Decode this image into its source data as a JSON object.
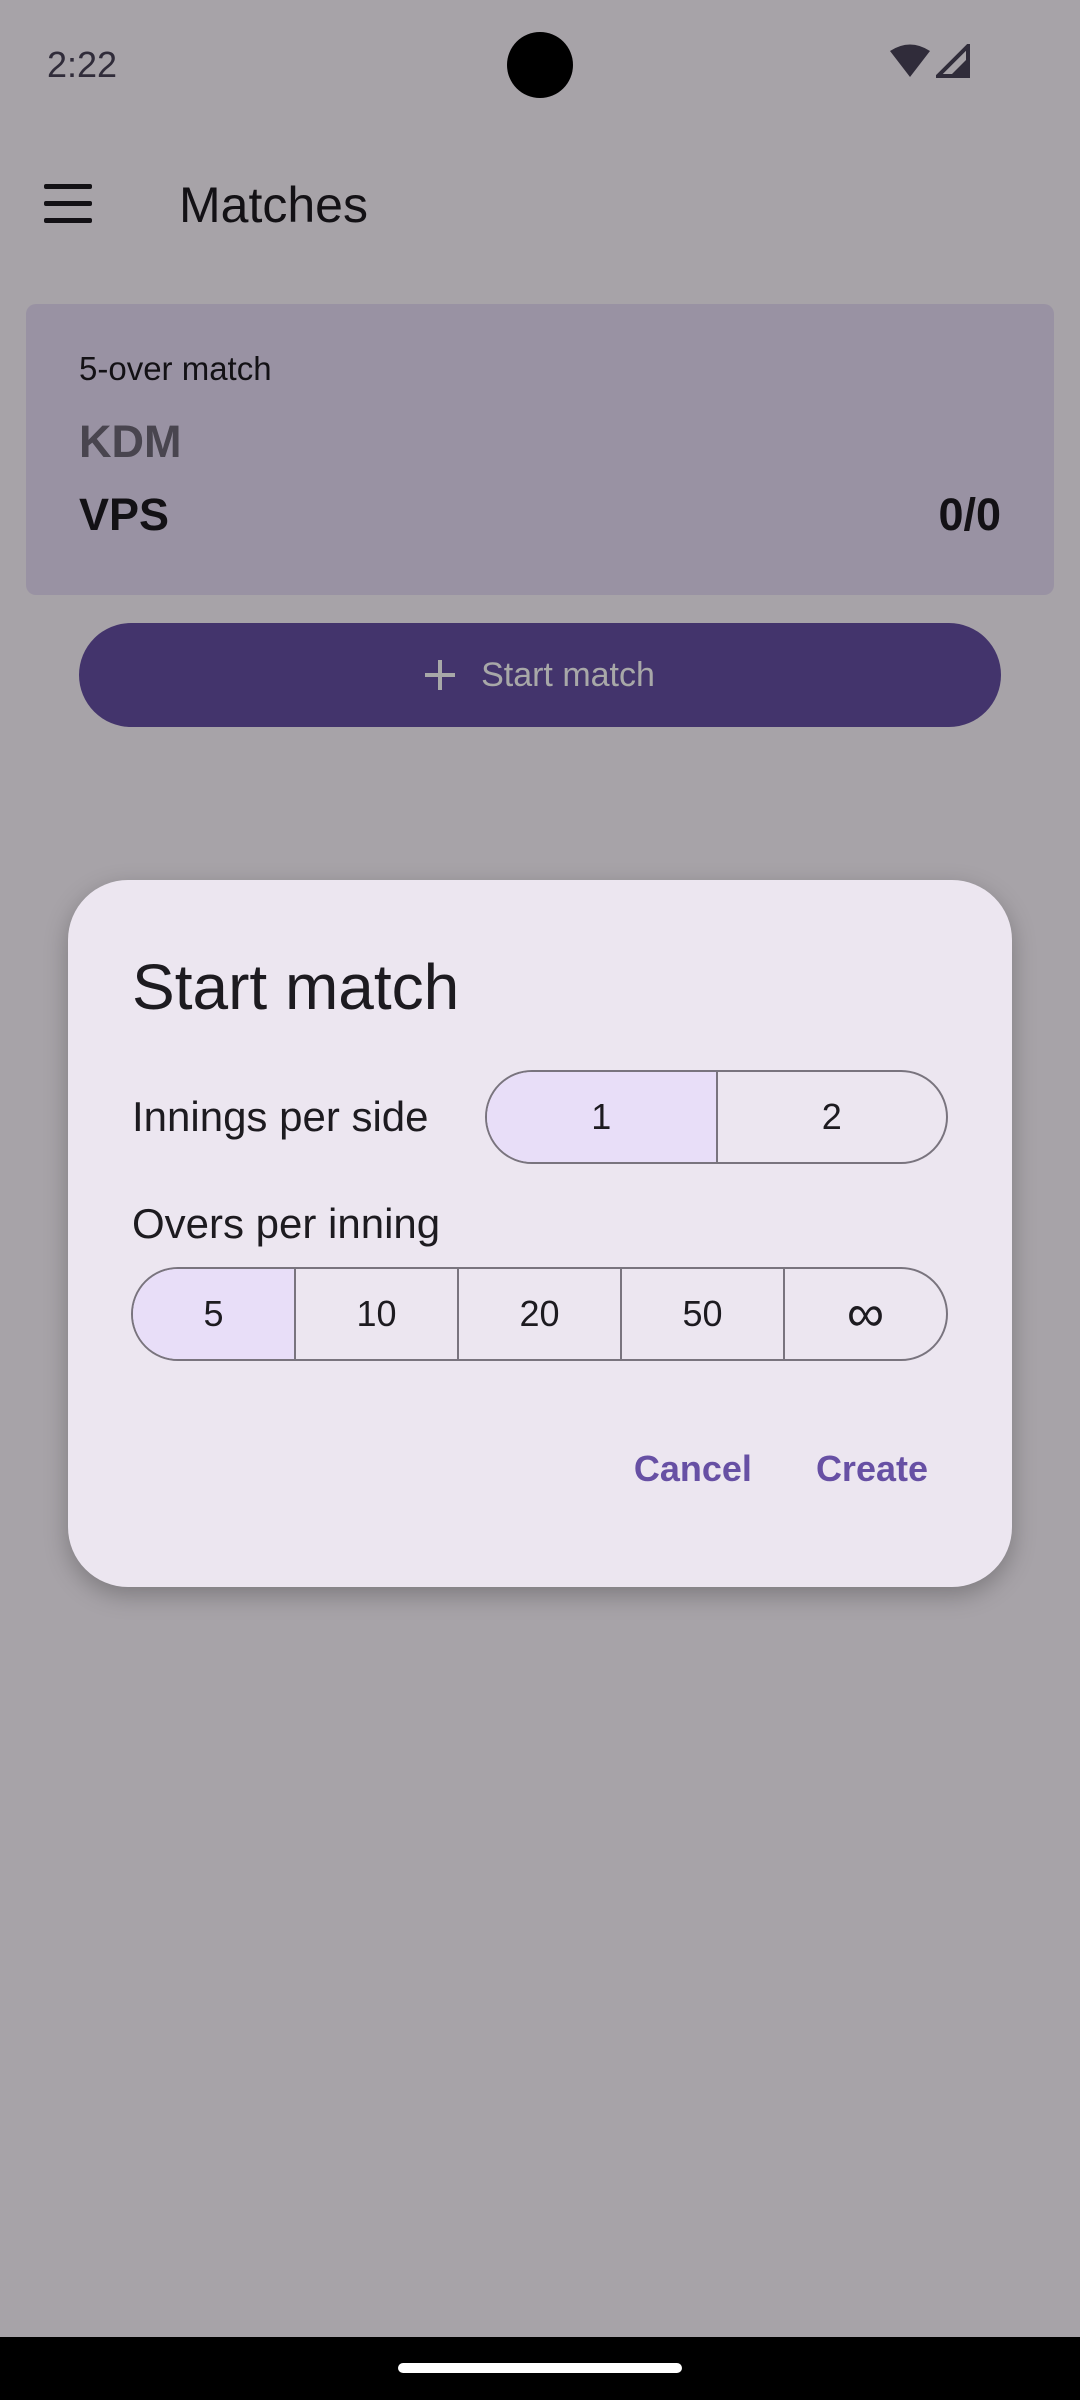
{
  "status_bar": {
    "time": "2:22",
    "wifi_icon": "wifi-icon",
    "signal_icon": "cell-signal-icon"
  },
  "app_bar": {
    "menu_icon": "hamburger-menu-icon",
    "title": "Matches"
  },
  "match_card": {
    "match_type": "5-over match",
    "team_a": "KDM",
    "team_b": "VPS",
    "team_b_score": "0/0"
  },
  "start_button": {
    "icon": "plus-icon",
    "label": "Start match"
  },
  "dialog": {
    "title": "Start match",
    "innings_label": "Innings per side",
    "innings_options": [
      "1",
      "2"
    ],
    "innings_selected": "1",
    "overs_label": "Overs per inning",
    "overs_options": [
      "5",
      "10",
      "20",
      "50",
      "∞"
    ],
    "overs_selected": "5",
    "cancel_label": "Cancel",
    "create_label": "Create"
  },
  "colors": {
    "primary": "#6750a4",
    "selected_segment": "#e8def8",
    "surface": "#ece6f0"
  }
}
